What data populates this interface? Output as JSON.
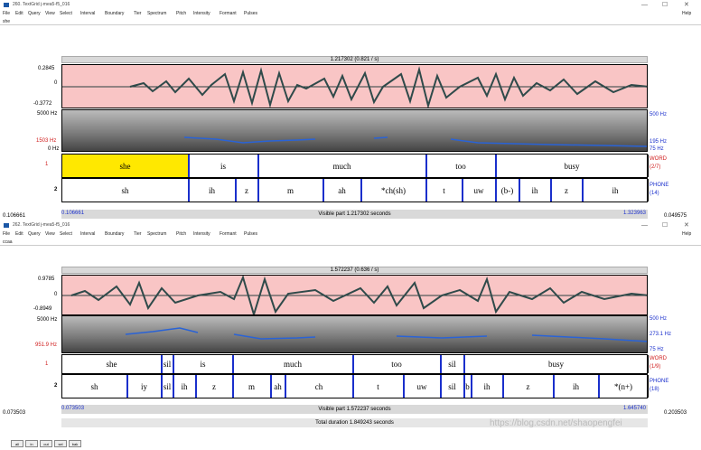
{
  "win1": {
    "title": "260. TextGrid j-mea5-f5_016",
    "menu": [
      "File",
      "Edit",
      "Query",
      "View",
      "Select",
      "Interval",
      "Boundary",
      "Tier",
      "Spectrum",
      "Pitch",
      "Intensity",
      "Formant",
      "Pulses"
    ],
    "help": "Help",
    "text": "she",
    "topbar": "1.217302 (0.821 / s)",
    "wave_max": "0.2845",
    "wave_zero": "0",
    "wave_min": "-0.3772",
    "spec_top": "5000 Hz",
    "spec_pitch": "1503 Hz",
    "spec_bottom": "0 Hz",
    "right_top": "500 Hz",
    "right_mid": "195 Hz",
    "right_low": "75 Hz",
    "tier1": {
      "num": "1",
      "name": "WORD",
      "count": "(2/7)",
      "intervals": [
        {
          "t": "she",
          "w": 140,
          "sel": true
        },
        {
          "t": "is",
          "w": 77
        },
        {
          "t": "much",
          "w": 186
        },
        {
          "t": "too",
          "w": 77
        },
        {
          "t": "busy",
          "w": 169
        }
      ]
    },
    "tier2": {
      "num": "2",
      "name": "PHONE",
      "count": "(14)",
      "intervals": [
        {
          "t": "sh",
          "w": 140
        },
        {
          "t": "ih",
          "w": 52
        },
        {
          "t": "z",
          "w": 25
        },
        {
          "t": "m",
          "w": 72
        },
        {
          "t": "ah",
          "w": 42
        },
        {
          "t": "*ch(sh)",
          "w": 72
        },
        {
          "t": "t",
          "w": 40
        },
        {
          "t": "uw",
          "w": 37
        },
        {
          "t": "(b-)",
          "w": 26
        },
        {
          "t": "ih",
          "w": 35
        },
        {
          "t": "z",
          "w": 35
        },
        {
          "t": "ih",
          "w": 73
        }
      ]
    },
    "left_time": "0.106661",
    "view_start": "0.106661",
    "visible": "Visible part 1.217302 seconds",
    "view_end": "1.323963",
    "right_time": "0.049575"
  },
  "win2": {
    "title": "262. TextGrid j-mea5-f5_016",
    "menu": [
      "File",
      "Edit",
      "Query",
      "View",
      "Select",
      "Interval",
      "Boundary",
      "Tier",
      "Spectrum",
      "Pitch",
      "Intensity",
      "Formant",
      "Pulses"
    ],
    "help": "Help",
    "text": "ccaa",
    "topbar": "1.572237 (0.636 / s)",
    "wave_max": "0.9785",
    "wave_zero": "0",
    "wave_min": "-0.8949",
    "spec_top": "5000 Hz",
    "spec_pitch": "951.9 Hz",
    "spec_bottom": "",
    "right_top": "500 Hz",
    "right_mid": "273.1 Hz",
    "right_low": "75 Hz",
    "tier1": {
      "num": "1",
      "name": "WORD",
      "count": "(1/9)",
      "intervals": [
        {
          "t": "she",
          "w": 110
        },
        {
          "t": "sil",
          "w": 13
        },
        {
          "t": "is",
          "w": 66
        },
        {
          "t": "much",
          "w": 133
        },
        {
          "t": "too",
          "w": 97
        },
        {
          "t": "sil",
          "w": 26
        },
        {
          "t": "busy",
          "w": 204
        }
      ]
    },
    "tier2": {
      "num": "2",
      "name": "PHONE",
      "count": "(18)",
      "intervals": [
        {
          "t": "sh",
          "w": 72
        },
        {
          "t": "iy",
          "w": 38
        },
        {
          "t": "sil",
          "w": 13
        },
        {
          "t": "ih",
          "w": 25
        },
        {
          "t": "z",
          "w": 41
        },
        {
          "t": "m",
          "w": 42
        },
        {
          "t": "ah",
          "w": 16
        },
        {
          "t": "ch",
          "w": 75
        },
        {
          "t": "t",
          "w": 56
        },
        {
          "t": "uw",
          "w": 41
        },
        {
          "t": "sil",
          "w": 26
        },
        {
          "t": "b",
          "w": 8
        },
        {
          "t": "ih",
          "w": 35
        },
        {
          "t": "z",
          "w": 56
        },
        {
          "t": "ih",
          "w": 50
        },
        {
          "t": "*(n+)",
          "w": 55
        }
      ]
    },
    "left_time": "0.073503",
    "view_start": "0.073503",
    "visible": "Visible part 1.572237 seconds",
    "view_end": "1.645740",
    "right_time": "0.203503",
    "total": "Total duration 1.849243 seconds",
    "buttons": [
      "all",
      "in",
      "out",
      "sel",
      "bak"
    ]
  },
  "watermark": "https://blog.csdn.net/shaopengfei"
}
